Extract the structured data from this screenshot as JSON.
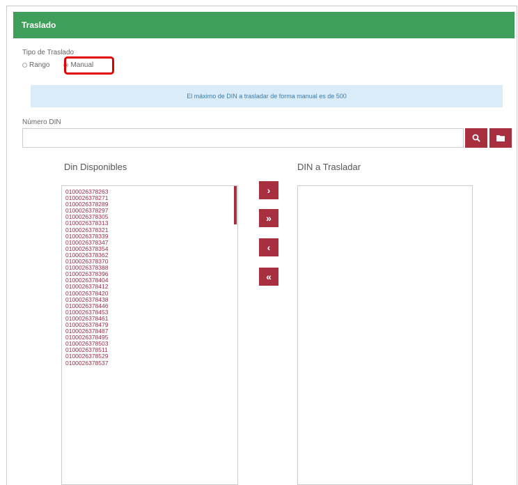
{
  "panel": {
    "title": "Traslado"
  },
  "tipo": {
    "label": "Tipo de Traslado",
    "options": [
      {
        "label": "Rango",
        "checked": false
      },
      {
        "label": "Manual",
        "checked": true
      }
    ]
  },
  "info": {
    "message": "El máximo de DIN a trasladar de forma manual es de 500"
  },
  "numero": {
    "label": "Número DIN",
    "value": ""
  },
  "icons": {
    "search": "search-icon",
    "folder": "folder-icon"
  },
  "disponibles": {
    "title": "Din Disponibles",
    "items": [
      "0100026378263",
      "0100026378271",
      "0100026378289",
      "0100026378297",
      "0100026378305",
      "0100026378313",
      "0100026378321",
      "0100026378339",
      "0100026378347",
      "0100026378354",
      "0100026378362",
      "0100026378370",
      "0100026378388",
      "0100026378396",
      "0100026378404",
      "0100026378412",
      "0100026378420",
      "0100026378438",
      "0100026378446",
      "0100026378453",
      "0100026378461",
      "0100026378479",
      "0100026378487",
      "0100026378495",
      "0100026378503",
      "0100026378511",
      "0100026378529",
      "0100026378537"
    ]
  },
  "trasladar": {
    "title": "DIN a Trasladar",
    "items": []
  },
  "move_buttons": {
    "add": "›",
    "add_all": "»",
    "remove": "‹",
    "remove_all": "«"
  },
  "colors": {
    "header": "#3f9e5a",
    "accent": "#a8303e",
    "info_bg": "#d9ecf7",
    "highlight": "#e00000"
  }
}
